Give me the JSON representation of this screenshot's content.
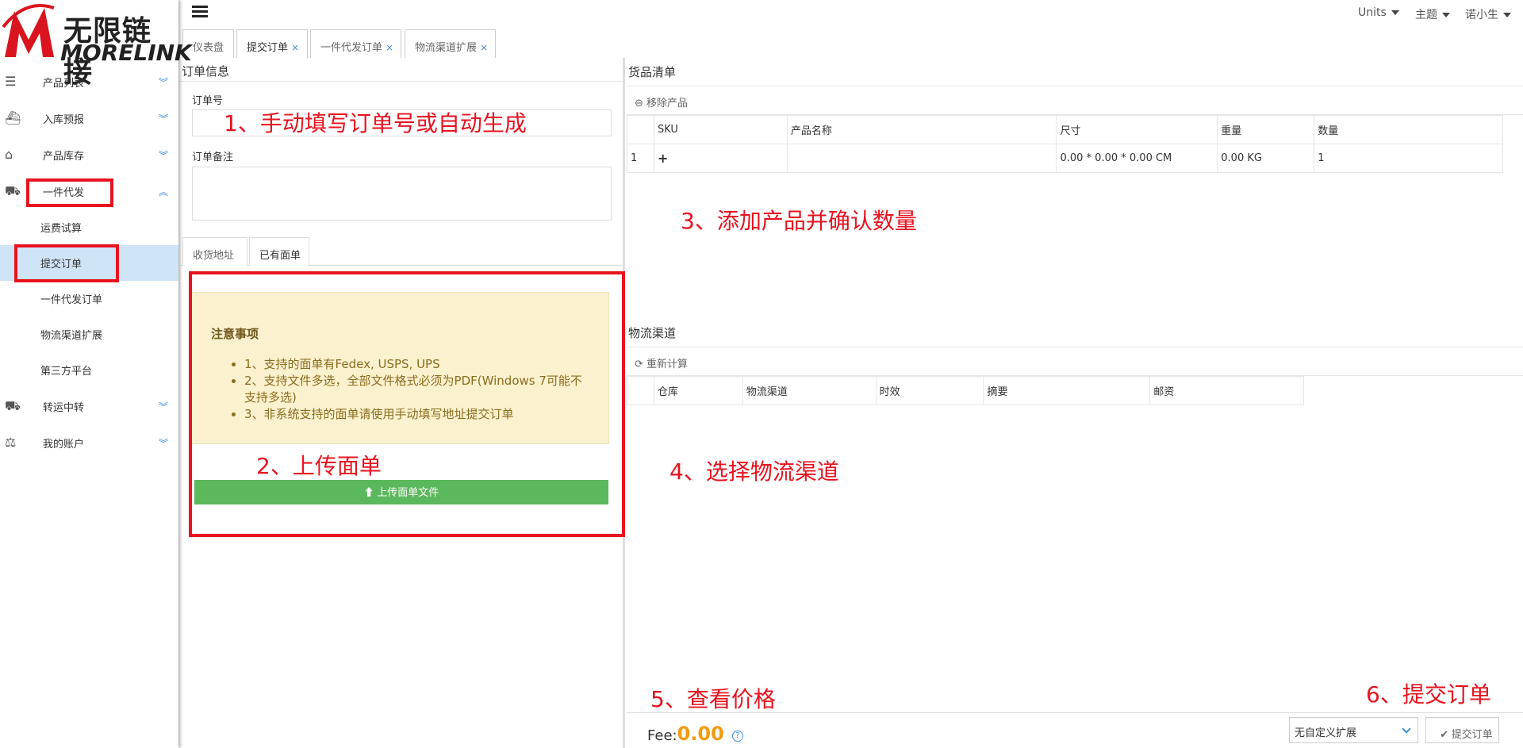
{
  "logo": {
    "cn": "无限链接",
    "en": "MORELINK"
  },
  "sidebar": {
    "items": [
      {
        "label": "产品列表",
        "icon": "list-icon"
      },
      {
        "label": "入库预报",
        "icon": "ship-icon"
      },
      {
        "label": "产品库存",
        "icon": "inbox-icon"
      },
      {
        "label": "一件代发",
        "icon": "truck-icon"
      }
    ],
    "subitems": [
      "运费试算",
      "提交订单",
      "一件代发订单",
      "物流渠道扩展",
      "第三方平台"
    ],
    "items2": [
      {
        "label": "转运中转",
        "icon": "truck-icon"
      },
      {
        "label": "我的账户",
        "icon": "scale-icon"
      }
    ]
  },
  "topbar": {
    "units": "Units",
    "theme": "主题",
    "user": "诺小生"
  },
  "tabs": [
    {
      "label": "仪表盘",
      "close": ""
    },
    {
      "label": "提交订单",
      "close": "×"
    },
    {
      "label": "一件代发订单",
      "close": "×"
    },
    {
      "label": "物流渠道扩展",
      "close": "×"
    }
  ],
  "order": {
    "title": "订单信息",
    "number_label": "订单号",
    "remark_label": "订单备注",
    "tab_address": "收货地址",
    "tab_label": "已有面单",
    "notice_title": "注意事项",
    "notices": [
      "1、支持的面单有Fedex, USPS, UPS",
      "2、支持文件多选，全部文件格式必须为PDF(Windows 7可能不支持多选)",
      "3、非系统支持的面单请使用手动填写地址提交订单"
    ],
    "upload_button": "上传面单文件"
  },
  "goods": {
    "title": "货品清单",
    "remove": "移除产品",
    "columns": [
      "SKU",
      "产品名称",
      "尺寸",
      "重量",
      "数量"
    ],
    "row": {
      "index": "1",
      "sku": "+",
      "name": "",
      "size": "0.00 * 0.00 * 0.00 CM",
      "weight": "0.00 KG",
      "qty": "1"
    }
  },
  "logistics": {
    "title": "物流渠道",
    "recalc": "重新计算",
    "columns": [
      "仓库",
      "物流渠道",
      "时效",
      "摘要",
      "邮资"
    ]
  },
  "footer": {
    "fee_label": "Fee:",
    "fee_value": "0.00",
    "ext_select": "无自定义扩展",
    "submit": "提交订单"
  },
  "annotations": {
    "a1": "1、手动填写订单号或自动生成",
    "a2": "2、上传面单",
    "a3": "3、添加产品并确认数量",
    "a4": "4、选择物流渠道",
    "a5": "5、查看价格",
    "a6": "6、提交订单"
  },
  "colors": {
    "annotation": "#e8131f",
    "upload_button": "#5cb85c",
    "fee": "#f39c12",
    "active_menu": "#cfe4f7"
  }
}
